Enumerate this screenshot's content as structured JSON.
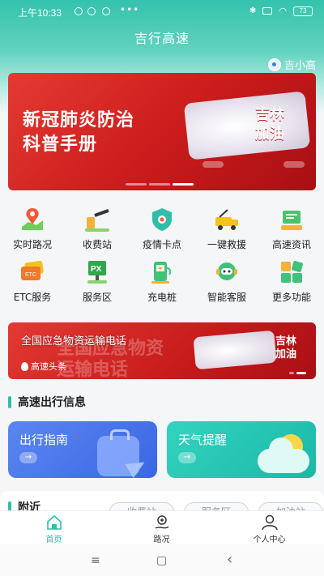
{
  "status_bar": {
    "time": "上午10:33",
    "dots": "•••",
    "battery": "73"
  },
  "app": {
    "title": "吉行高速",
    "assistant_name": "吉小高"
  },
  "banner": {
    "line1": "新冠肺炎防治",
    "line2": "科普手册",
    "badge_line1": "吉林",
    "badge_line2": "加油"
  },
  "services": [
    {
      "label": "实时路况",
      "icon": "map-pin-icon"
    },
    {
      "label": "收费站",
      "icon": "toll-gate-icon"
    },
    {
      "label": "疫情卡点",
      "icon": "virus-shield-icon"
    },
    {
      "label": "一键救援",
      "icon": "tow-truck-icon"
    },
    {
      "label": "高速资讯",
      "icon": "news-icon"
    },
    {
      "label": "ETC服务",
      "icon": "etc-card-icon"
    },
    {
      "label": "服务区",
      "icon": "px-service-icon"
    },
    {
      "label": "充电桩",
      "icon": "charging-pile-icon"
    },
    {
      "label": "智能客服",
      "icon": "robot-icon"
    },
    {
      "label": "更多功能",
      "icon": "grid-more-icon"
    }
  ],
  "news": {
    "headline": "全国应急物资运输电话",
    "ghost_line1": "全国应急物资",
    "ghost_line2": "运输电话",
    "badge_line1": "吉林",
    "badge_line2": "加油",
    "source": "高速头条"
  },
  "travel_info": {
    "title": "高速出行信息",
    "cards": [
      {
        "label": "出行指南",
        "arrow": "→"
      },
      {
        "label": "天气提醒",
        "arrow": "→"
      }
    ]
  },
  "nearby": {
    "title": "附近",
    "filters": [
      "收费站",
      "服务区",
      "加油站"
    ]
  },
  "tabbar": [
    {
      "label": "首页",
      "icon": "home-icon"
    },
    {
      "label": "路况",
      "icon": "route-icon"
    },
    {
      "label": "个人中心",
      "icon": "person-icon"
    }
  ],
  "system_nav": {
    "menu": "≡",
    "home": "▢",
    "back": "‹"
  },
  "colors": {
    "accent": "#2fbfa8",
    "banner_red": "#c91b1b",
    "card_blue": "#3a67e4",
    "card_teal": "#1ab8a6"
  }
}
